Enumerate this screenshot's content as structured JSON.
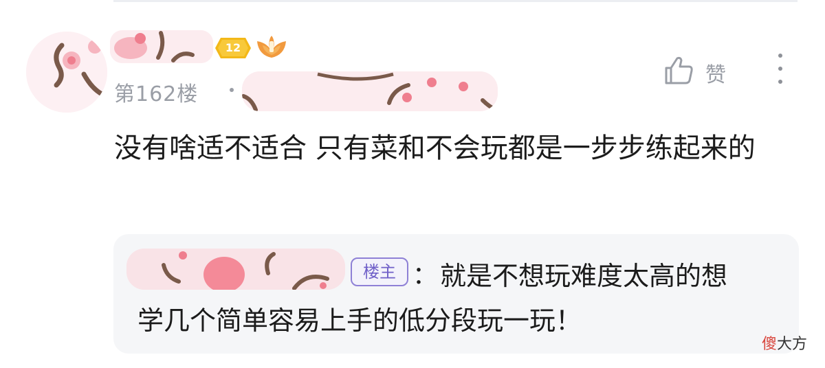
{
  "comment": {
    "level": "12",
    "floor_label": "第162楼",
    "like_label": "赞",
    "content": "没有啥适不适合 只有菜和不会玩都是一步步练起来的"
  },
  "reply": {
    "op_tag": "楼主",
    "colon": "：",
    "line1": "就是不想玩难度太高的想",
    "line2": "学几个简单容易上手的低分段玩一玩！"
  },
  "watermark": {
    "first_char": "傻",
    "rest": "大方"
  },
  "colors": {
    "text_primary": "#1b1b1b",
    "text_secondary": "#9a9ea6",
    "level_badge": "#f3b818",
    "op_tag": "#6f5fc8",
    "reply_bg": "#f5f6f8"
  },
  "icons": {
    "like": "thumb-up-icon",
    "more": "more-vertical-icon",
    "level": "level-badge-icon",
    "fan": "fan-badge-icon"
  }
}
